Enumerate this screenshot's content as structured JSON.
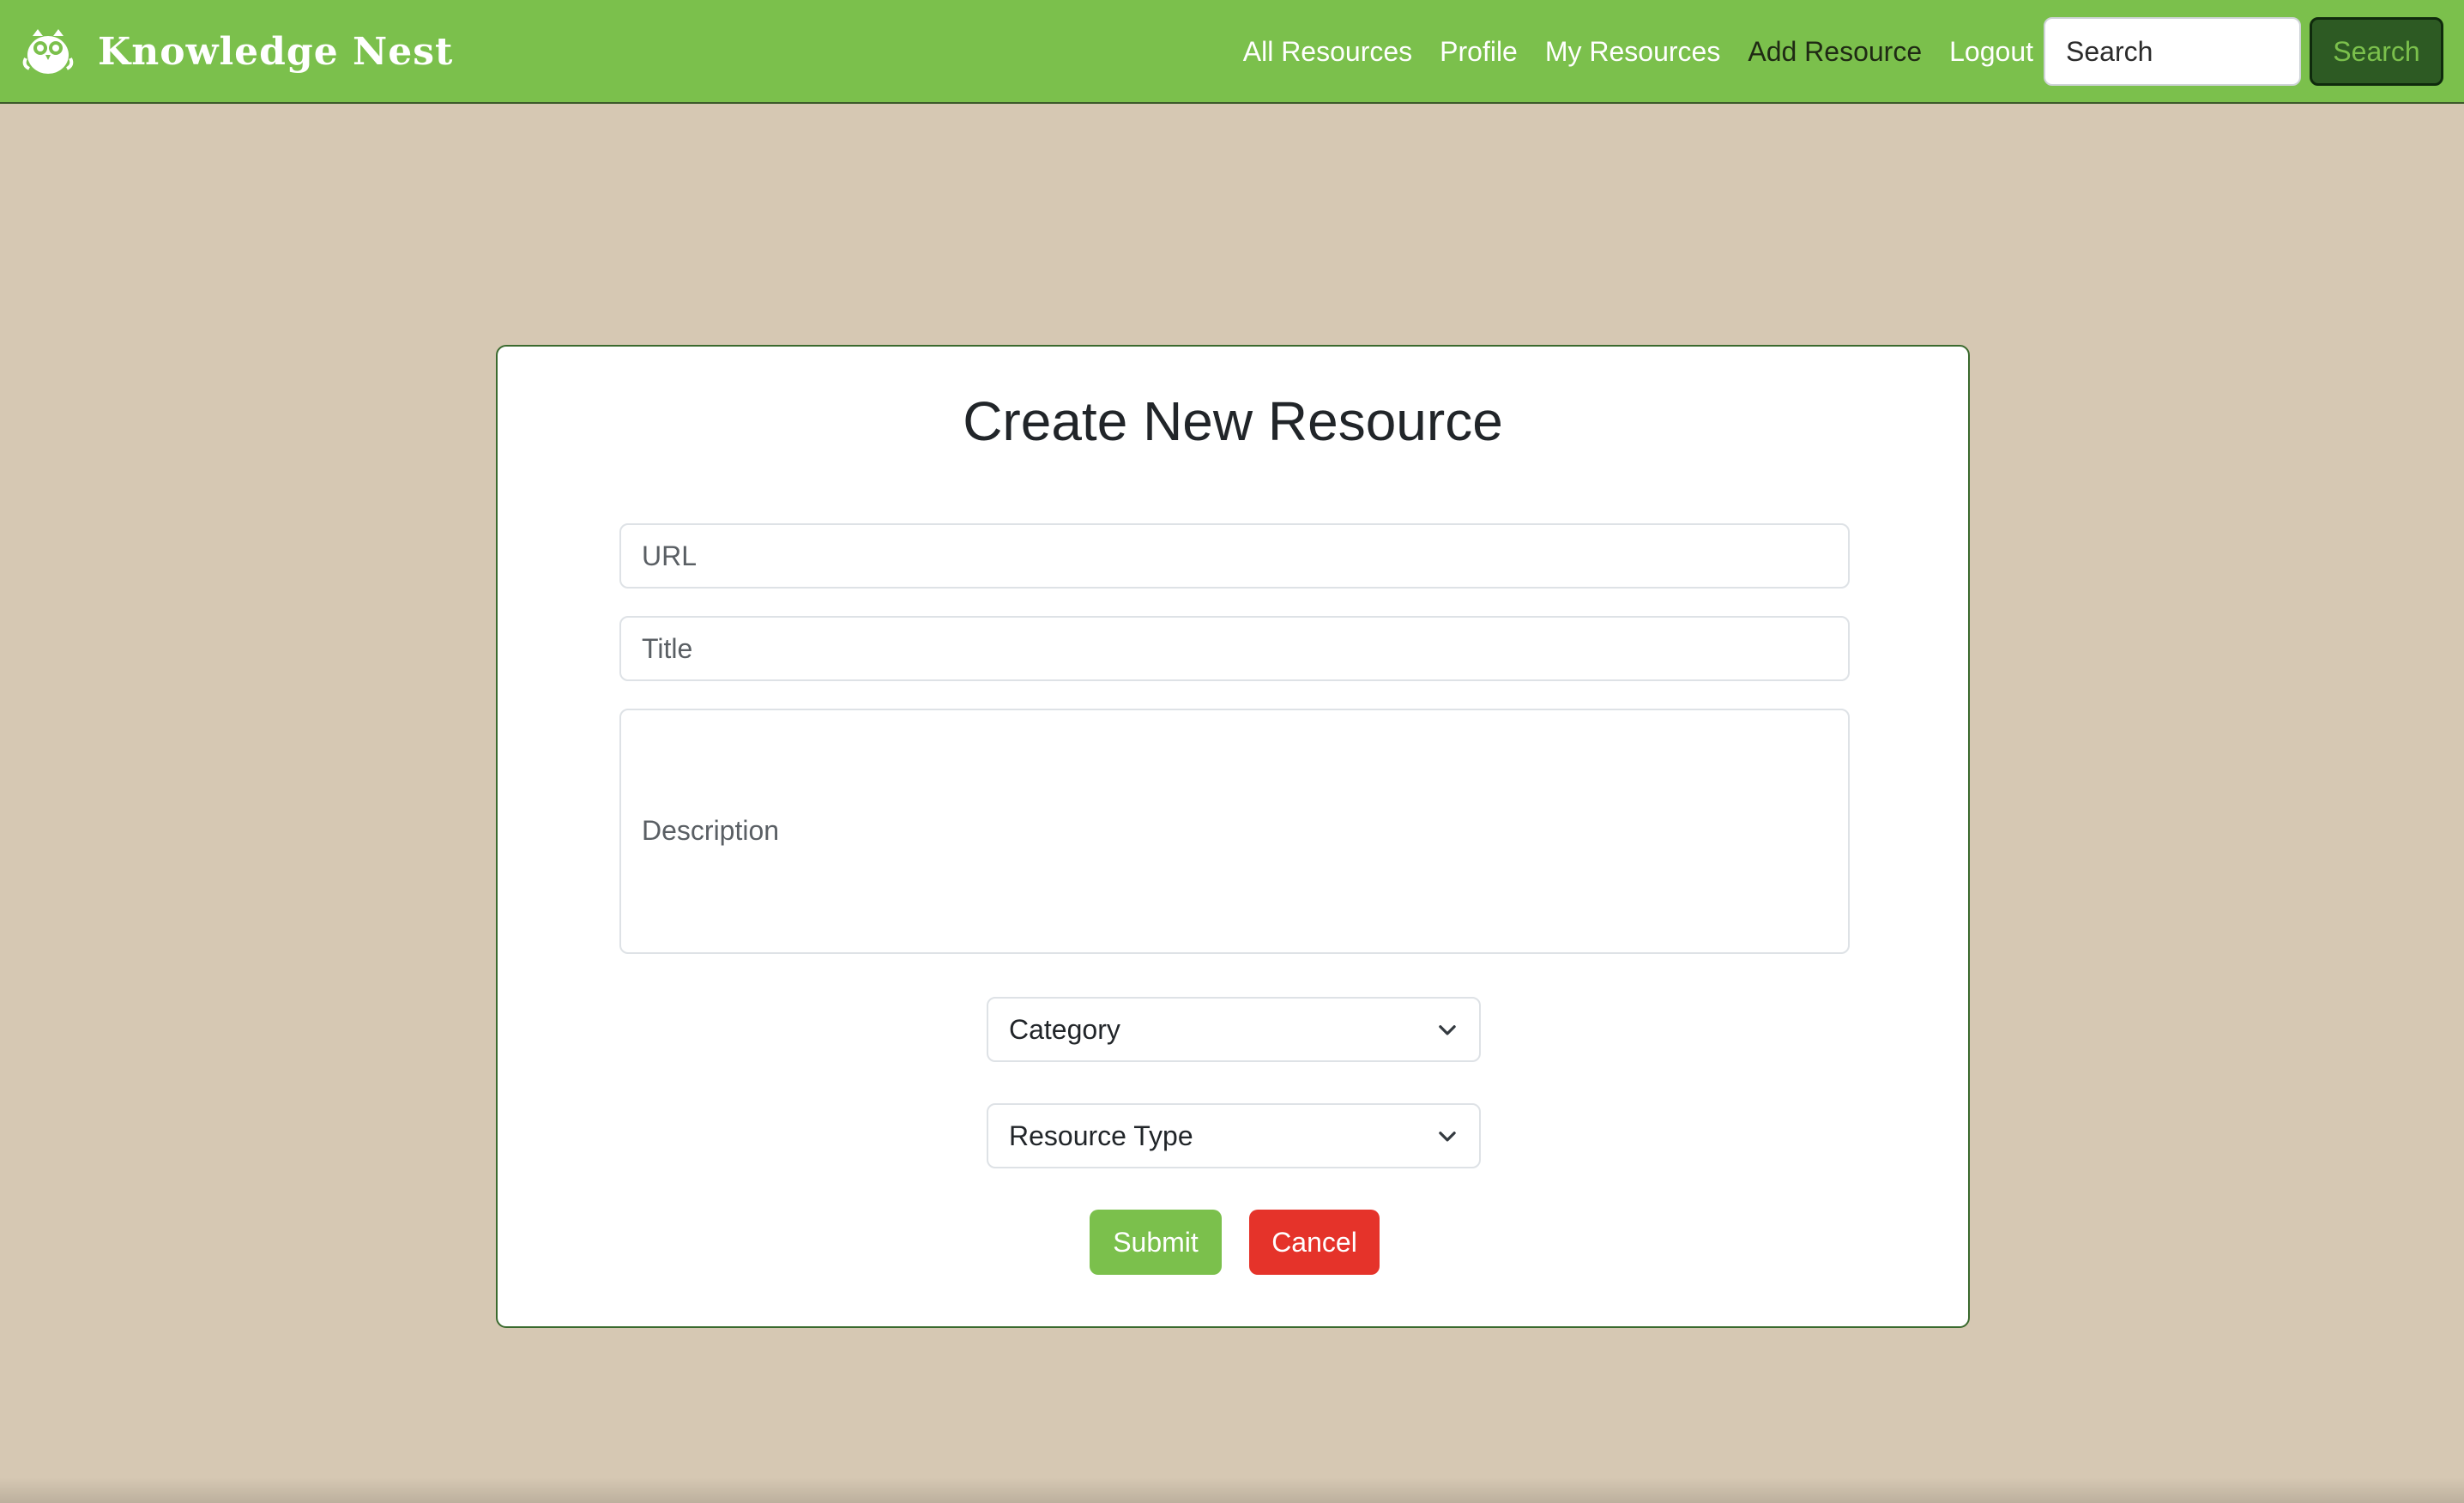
{
  "navbar": {
    "brand": "Knowledge Nest",
    "logo_icon": "owl-icon",
    "links": [
      {
        "label": "All Resources",
        "active": false
      },
      {
        "label": "Profile",
        "active": false
      },
      {
        "label": "My Resources",
        "active": false
      },
      {
        "label": "Add Resource",
        "active": true
      },
      {
        "label": "Logout",
        "active": false
      }
    ],
    "search_placeholder": "Search",
    "search_button": "Search"
  },
  "form": {
    "title": "Create New Resource",
    "url_placeholder": "URL",
    "title_placeholder": "Title",
    "description_placeholder": "Description",
    "category_selected": "Category",
    "resource_type_selected": "Resource Type",
    "submit_label": "Submit",
    "cancel_label": "Cancel"
  },
  "colors": {
    "navbar": "#7bc04c",
    "background": "#d6c8b3",
    "search_button": "#2d5a23",
    "submit": "#7bc04c",
    "cancel": "#e5332a"
  }
}
